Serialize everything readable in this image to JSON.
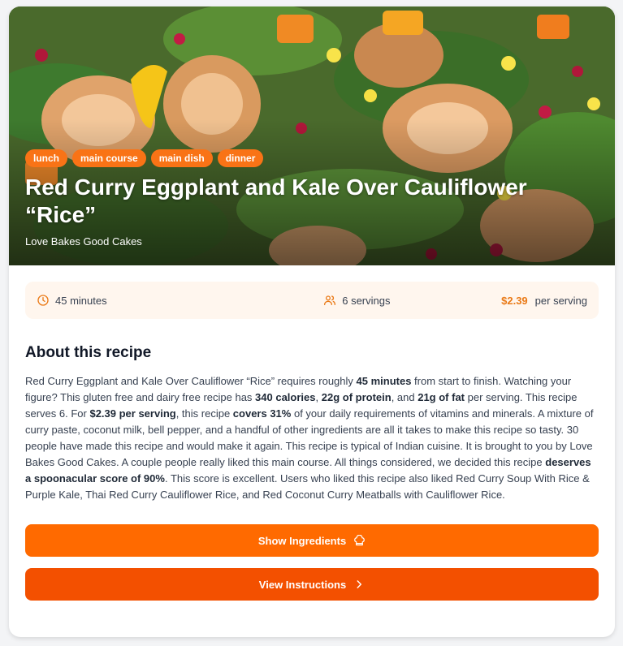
{
  "recipe": {
    "tags": [
      "lunch",
      "main course",
      "main dish",
      "dinner"
    ],
    "title": "Red Curry Eggplant and Kale Over Cauliflower “Rice”",
    "source": "Love Bakes Good Cakes"
  },
  "stats": {
    "time": "45 minutes",
    "servings": "6 servings",
    "price": "$2.39",
    "price_suffix": "per serving"
  },
  "about": {
    "heading": "About this recipe",
    "p1": "Red Curry Eggplant and Kale Over Cauliflower “Rice” requires roughly ",
    "b1": "45 minutes",
    "p2": " from start to finish. Watching your figure? This gluten free and dairy free recipe has ",
    "b2": "340 calories",
    "p3": ", ",
    "b3": "22g of protein",
    "p4": ", and ",
    "b4": "21g of fat",
    "p5": " per serving. This recipe serves 6. For ",
    "b5": "$2.39 per serving",
    "p6": ", this recipe ",
    "b6": "covers 31%",
    "p7": " of your daily requirements of vitamins and minerals. A mixture of curry paste, coconut milk, bell pepper, and a handful of other ingredients are all it takes to make this recipe so tasty. 30 people have made this recipe and would make it again. This recipe is typical of Indian cuisine. It is brought to you by Love Bakes Good Cakes. A couple people really liked this main course. All things considered, we decided this recipe ",
    "b7": "deserves a spoonacular score of 90%",
    "p8": ". This score is excellent. Users who liked this recipe also liked Red Curry Soup With Rice & Purple Kale, Thai Red Curry Cauliflower Rice, and Red Coconut Curry Meatballs with Cauliflower Rice."
  },
  "buttons": {
    "ingredients": "Show Ingredients",
    "instructions": "View Instructions"
  },
  "icons": {
    "time": "clock-icon",
    "servings": "users-icon",
    "ingredients": "chef-hat-icon",
    "instructions": "chevron-right-icon"
  },
  "colors": {
    "accent": "#f97316",
    "button_primary": "#ff6a00",
    "button_secondary": "#f35000",
    "stats_bg": "#fff6ee"
  }
}
